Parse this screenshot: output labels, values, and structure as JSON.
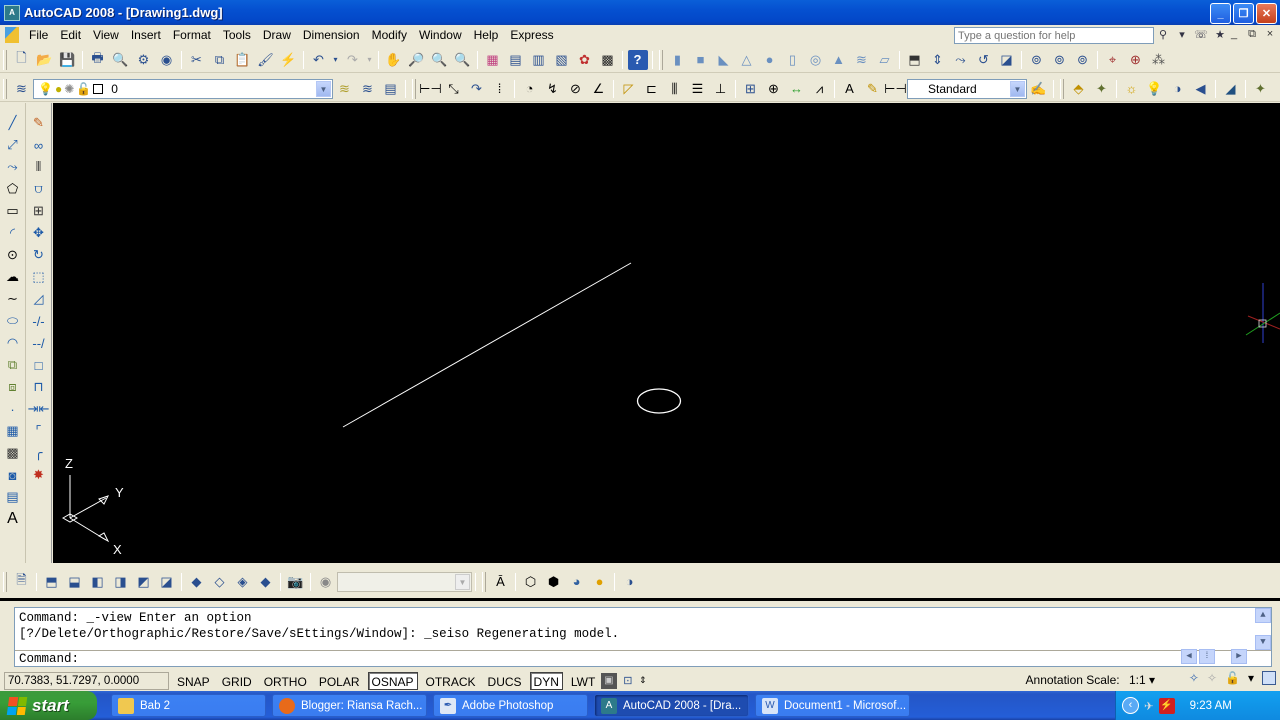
{
  "window": {
    "title": "AutoCAD 2008 - [Drawing1.dwg]",
    "app_icon": "autocad-logo-icon",
    "controls": [
      "minimize",
      "restore",
      "close"
    ]
  },
  "menubar": {
    "items": [
      "File",
      "Edit",
      "View",
      "Insert",
      "Format",
      "Tools",
      "Draw",
      "Dimension",
      "Modify",
      "Window",
      "Help",
      "Express"
    ],
    "help_placeholder": "Type a question for help",
    "help_icons": [
      "search-icon",
      "dropdown-icon",
      "communication-center-icon",
      "favorites-star-icon"
    ],
    "mdi_controls": [
      "_",
      "⧉",
      "×"
    ]
  },
  "toolbar_standard": {
    "icons": [
      "new",
      "open",
      "save",
      "plot",
      "plot-preview",
      "publish",
      "3d-dwf",
      "cut",
      "copy",
      "paste",
      "match-properties",
      "block-editor",
      "undo",
      "redo",
      "pan",
      "zoom-realtime",
      "zoom-window",
      "zoom-previous",
      "properties",
      "design-center",
      "tool-palettes",
      "sheet-set",
      "markup",
      "quickcalc",
      "help"
    ]
  },
  "toolbar_modeling": {
    "icons": [
      "polysolid",
      "box",
      "wedge",
      "cone",
      "sphere",
      "cylinder",
      "torus",
      "pyramid",
      "helix",
      "planar-surface",
      "extrude",
      "presspull",
      "sweep",
      "revolve",
      "loft",
      "union",
      "subtract",
      "intersect",
      "3d-move",
      "3d-rotate",
      "3d-align"
    ]
  },
  "layers": {
    "current_layer": "0",
    "state_icons": [
      "on-bulb-icon",
      "freeze-sun-icon",
      "viewport-freeze-icon",
      "lock-icon",
      "color-swatch-icon"
    ]
  },
  "dimension_toolbar": {
    "icons": [
      "linear",
      "aligned",
      "arc-length",
      "ordinate",
      "radius",
      "jogged",
      "diameter",
      "angular",
      "quick-dim",
      "baseline",
      "continue",
      "dim-space",
      "dim-break",
      "tolerance",
      "center-mark",
      "inspection",
      "jogged-linear",
      "dim-edit",
      "dim-text-edit",
      "dim-update"
    ],
    "dim_style": "Standard"
  },
  "left_toolbar_draw": [
    "line",
    "construction-line",
    "polyline",
    "polygon",
    "rectangle",
    "arc",
    "circle",
    "revision-cloud",
    "spline",
    "ellipse",
    "ellipse-arc",
    "insert-block",
    "make-block",
    "point",
    "hatch",
    "gradient",
    "region",
    "table",
    "multiline-text"
  ],
  "left_toolbar_modify": [
    "erase",
    "copy",
    "mirror",
    "offset",
    "array",
    "move",
    "rotate",
    "scale",
    "stretch",
    "trim",
    "extend",
    "break-at-point",
    "break",
    "join",
    "chamfer",
    "fillet",
    "explode"
  ],
  "draw_glyphs": [
    "╱",
    "⤢",
    "⤳",
    "⬠",
    "▭",
    "◜",
    "⊙",
    "❁",
    "∼",
    "⬭",
    "◠",
    "⧉",
    "⧈",
    "·",
    "▦",
    "▧",
    "◎",
    "▦",
    "A"
  ],
  "modify_glyphs": [
    "✎",
    "⧉",
    "‖",
    "⊓",
    "▦",
    "✛",
    "↻",
    "⬚",
    "◿",
    "-/-",
    "--/",
    "□",
    "□",
    "⇉",
    "⌜",
    "╭",
    "✹"
  ],
  "ucs": {
    "x_label": "X",
    "y_label": "Y",
    "z_label": "Z"
  },
  "view_toolbar": {
    "icons": [
      "named-views",
      "top-view",
      "bottom-view",
      "left-view",
      "right-view",
      "front-view",
      "back-view",
      "sw-isometric",
      "se-isometric",
      "ne-isometric",
      "nw-isometric",
      "camera",
      "previous-view"
    ],
    "view_dropdown_value": "",
    "visual_style_icons": [
      "2d-wireframe",
      "3d-wireframe",
      "3d-hidden",
      "realistic",
      "conceptual",
      "visual-style-manager"
    ]
  },
  "command": {
    "history": [
      "Command: _-view Enter an option",
      "[?/Delete/Orthographic/Restore/Save/sEttings/Window]: _seiso Regenerating model."
    ],
    "prompt": "Command:",
    "input_value": ""
  },
  "statusbar": {
    "coordinates": "70.7383, 51.7297, 0.0000",
    "toggles": [
      {
        "label": "SNAP",
        "on": false
      },
      {
        "label": "GRID",
        "on": false
      },
      {
        "label": "ORTHO",
        "on": false
      },
      {
        "label": "POLAR",
        "on": false
      },
      {
        "label": "OSNAP",
        "on": true
      },
      {
        "label": "OTRACK",
        "on": false
      },
      {
        "label": "DUCS",
        "on": false
      },
      {
        "label": "DYN",
        "on": true
      },
      {
        "label": "LWT",
        "on": false
      }
    ],
    "annotation_scale_label": "Annotation Scale:",
    "annotation_scale_value": "1:1 ▾"
  },
  "taskbar": {
    "start_label": "start",
    "tasks": [
      {
        "label": "Bab 2",
        "icon": "folder-icon",
        "color": "#f0c850",
        "active": false
      },
      {
        "label": "Blogger: Riansa Rach...",
        "icon": "firefox-icon",
        "color": "#e86a1a",
        "active": false
      },
      {
        "label": "Adobe Photoshop",
        "icon": "photoshop-icon",
        "color": "#dfe8f5",
        "active": false
      },
      {
        "label": "AutoCAD 2008 - [Dra...",
        "icon": "autocad-icon",
        "color": "#2d7a8a",
        "active": true
      },
      {
        "label": "Document1 - Microsof...",
        "icon": "word-icon",
        "color": "#d8e4f8",
        "active": false
      }
    ],
    "tray_icons": [
      "help-icon",
      "restore-icon",
      "show-hidden-icon",
      "network-icon",
      "antivirus-icon"
    ],
    "clock": "9:23 AM"
  },
  "colors": {
    "canvas_bg": "#000000",
    "entity": "#ffffff",
    "title_bar": "#0550d0",
    "xp_taskbar": "#245ed8",
    "start_green": "#389d38"
  }
}
